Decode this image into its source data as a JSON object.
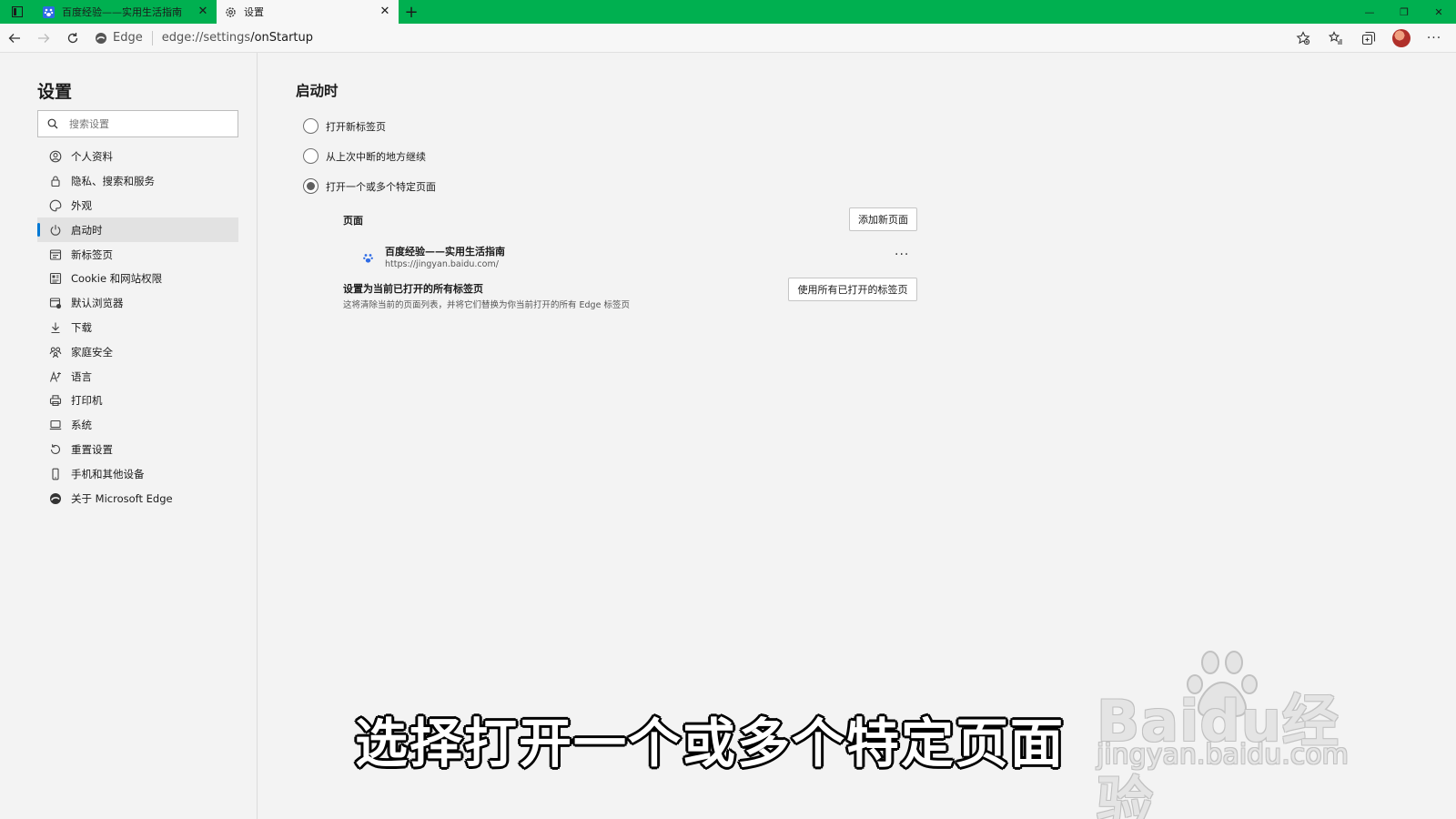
{
  "colors": {
    "titlebar": "#00b050",
    "accent": "#0078d4"
  },
  "tabs": [
    {
      "title": "百度经验——实用生活指南",
      "icon": "baidu-paw-icon",
      "active": false
    },
    {
      "title": "设置",
      "icon": "gear-icon",
      "active": true
    }
  ],
  "address": {
    "site_chip": "Edge",
    "url_host": "edge://settings",
    "url_path": "/onStartup"
  },
  "sidebar": {
    "title": "设置",
    "search_placeholder": "搜索设置",
    "items": [
      {
        "label": "个人资料",
        "icon": "profile-icon"
      },
      {
        "label": "隐私、搜索和服务",
        "icon": "lock-icon"
      },
      {
        "label": "外观",
        "icon": "appearance-icon"
      },
      {
        "label": "启动时",
        "icon": "power-icon",
        "active": true
      },
      {
        "label": "新标签页",
        "icon": "new-tab-icon"
      },
      {
        "label": "Cookie 和网站权限",
        "icon": "cookie-icon"
      },
      {
        "label": "默认浏览器",
        "icon": "default-browser-icon"
      },
      {
        "label": "下载",
        "icon": "download-icon"
      },
      {
        "label": "家庭安全",
        "icon": "family-icon"
      },
      {
        "label": "语言",
        "icon": "language-icon"
      },
      {
        "label": "打印机",
        "icon": "printer-icon"
      },
      {
        "label": "系统",
        "icon": "system-icon"
      },
      {
        "label": "重置设置",
        "icon": "reset-icon"
      },
      {
        "label": "手机和其他设备",
        "icon": "phone-icon"
      },
      {
        "label": "关于 Microsoft Edge",
        "icon": "edge-icon"
      }
    ]
  },
  "main": {
    "title": "启动时",
    "options": [
      {
        "label": "打开新标签页",
        "checked": false
      },
      {
        "label": "从上次中断的地方继续",
        "checked": false
      },
      {
        "label": "打开一个或多个特定页面",
        "checked": true
      }
    ],
    "pages_label": "页面",
    "add_page_button": "添加新页面",
    "site": {
      "title": "百度经验——实用生活指南",
      "url": "https://jingyan.baidu.com/",
      "more": "···"
    },
    "set_current": {
      "title": "设置为当前已打开的所有标签页",
      "desc": "这将清除当前的页面列表，并将它们替换为你当前打开的所有 Edge 标签页",
      "button": "使用所有已打开的标签页"
    }
  },
  "overlay": {
    "caption": "选择打开一个或多个特定页面",
    "watermark_logo": "Baidu经验",
    "watermark_url": "jingyan.baidu.com"
  }
}
